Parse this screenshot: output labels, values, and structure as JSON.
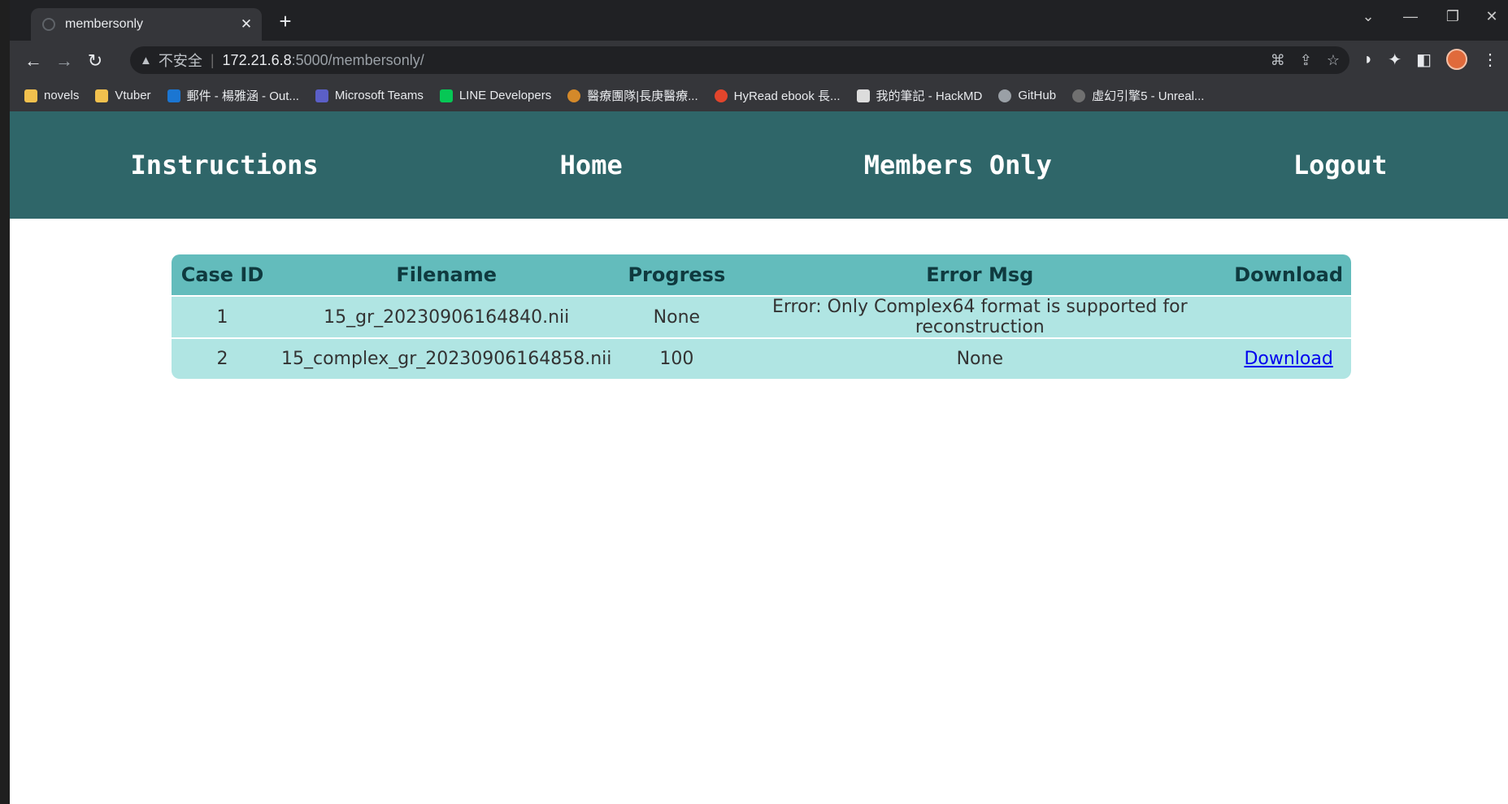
{
  "browser": {
    "tab_title": "membersonly",
    "address": {
      "insecure_label": "不安全",
      "host": "172.21.6.8",
      "path": ":5000/membersonly/"
    },
    "bookmarks": [
      {
        "label": "novels",
        "icon": "folder-icon"
      },
      {
        "label": "Vtuber",
        "icon": "folder-icon"
      },
      {
        "label": "郵件 - 楊雅涵 - Out...",
        "icon": "outlook-icon"
      },
      {
        "label": "Microsoft Teams",
        "icon": "teams-icon"
      },
      {
        "label": "LINE Developers",
        "icon": "line-icon"
      },
      {
        "label": "醫療團隊|長庚醫療...",
        "icon": "hospital-icon"
      },
      {
        "label": "HyRead ebook 長...",
        "icon": "hyread-icon"
      },
      {
        "label": "我的筆記 - HackMD",
        "icon": "document-icon"
      },
      {
        "label": "GitHub",
        "icon": "github-icon"
      },
      {
        "label": "虛幻引擎5 - Unreal...",
        "icon": "unreal-icon"
      }
    ]
  },
  "nav": {
    "instructions": "Instructions",
    "home": "Home",
    "members_only": "Members Only",
    "logout": "Logout"
  },
  "table": {
    "headers": [
      "Case ID",
      "Filename",
      "Progress",
      "Error Msg",
      "Download"
    ],
    "rows": [
      {
        "case_id": "1",
        "filename": "15_gr_20230906164840.nii",
        "progress": "None",
        "error": "Error: Only Complex64 format is supported for reconstruction",
        "download": ""
      },
      {
        "case_id": "2",
        "filename": "15_complex_gr_20230906164858.nii",
        "progress": "100",
        "error": "None",
        "download": "Download"
      }
    ]
  },
  "colors": {
    "header_bg": "#2f6669",
    "table_head_bg": "#63bcbc",
    "table_row_bg": "#b0e5e3",
    "link": "#0000ee"
  }
}
